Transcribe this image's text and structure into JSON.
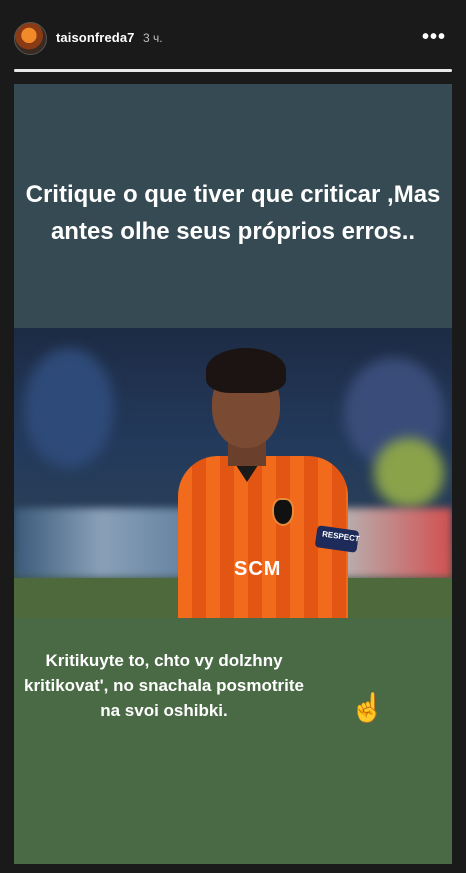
{
  "header": {
    "username": "taisonfreda7",
    "time": "3 ч.",
    "more_icon": "more-horizontal-icon",
    "more_label": "•••",
    "progress": 1.0
  },
  "story": {
    "top_text": "Critique o que tiver que criticar ,Mas antes olhe seus próprios erros..",
    "photo": {
      "sponsor": "SCM",
      "armband": "RESPECT"
    },
    "bottom_text": "Kritikuyte to, chto vy dolzhny kritikovat', no snachala posmotrite na svoi oshibki.",
    "emoji": "☝"
  },
  "colors": {
    "top_panel": "#354a52",
    "bottom_panel": "#4a6a46",
    "jersey": "#f26a1b"
  }
}
